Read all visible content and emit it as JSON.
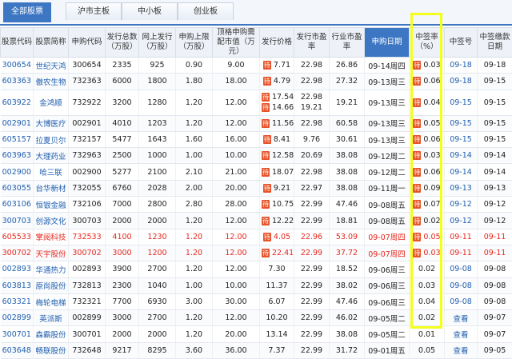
{
  "tabs": [
    "全部股票",
    "沪市主板",
    "中小板",
    "创业板"
  ],
  "headers": [
    "股票代码",
    "股票简称",
    "申购代码",
    "发行总数（万股）",
    "网上发行（万股）",
    "申购上限（万股）",
    "顶格申购需配市值（万元）",
    "发行价格",
    "发行市盈率",
    "行业市盈率",
    "申购日期",
    "中签率（%）",
    "中签号",
    "中签缴款日期"
  ],
  "tag_label": "待",
  "rows": [
    {
      "code": "300654",
      "name": "世纪天鸿",
      "sub": "300654",
      "total": "2335",
      "online": "925",
      "limit": "0.90",
      "cap": "9.00",
      "price": "7.71",
      "pe": "22.98",
      "ind": "26.86",
      "date": "09-14周四",
      "rate": "0.03",
      "lot": "09-18",
      "pay": "09-18",
      "tag": true
    },
    {
      "code": "603363",
      "name": "傲农生物",
      "sub": "732363",
      "total": "6000",
      "online": "1800",
      "limit": "1.80",
      "cap": "18.00",
      "price": "4.79",
      "pe": "22.98",
      "ind": "27.32",
      "date": "09-13周三",
      "rate": "0.06",
      "lot": "09-18",
      "pay": "09-15",
      "tag": true
    },
    {
      "code": "603922",
      "name": "金鸿顺",
      "sub": "732922",
      "total": "3200",
      "online": "1280",
      "limit": "1.20",
      "cap": "12.00",
      "price": "17.54",
      "price2": "14.66",
      "pe": "22.98",
      "pe2": "19.21",
      "ind": "19.21",
      "date": "09-13周三",
      "rate": "0.04",
      "lot": "09-15",
      "pay": "09-15",
      "tag": true,
      "tall": true
    },
    {
      "code": "002901",
      "name": "大博医疗",
      "sub": "002901",
      "total": "4010",
      "online": "1203",
      "limit": "1.20",
      "cap": "12.00",
      "price": "11.56",
      "pe": "22.98",
      "ind": "60.58",
      "date": "09-13周三",
      "rate": "0.05",
      "lot": "09-15",
      "pay": "09-15",
      "tag": true
    },
    {
      "code": "605157",
      "name": "拉夏贝尔",
      "sub": "732157",
      "total": "5477",
      "online": "1643",
      "limit": "1.60",
      "cap": "16.00",
      "price": "8.41",
      "pe": "9.76",
      "ind": "30.61",
      "date": "09-13周三",
      "rate": "0.06",
      "lot": "09-15",
      "pay": "09-15",
      "tag": true
    },
    {
      "code": "603963",
      "name": "大理药业",
      "sub": "732963",
      "total": "2500",
      "online": "1000",
      "limit": "1.00",
      "cap": "10.00",
      "price": "12.58",
      "pe": "20.69",
      "ind": "38.08",
      "date": "09-12周二",
      "rate": "0.03",
      "lot": "09-14",
      "pay": "09-14",
      "tag": true
    },
    {
      "code": "002900",
      "name": "哈三联",
      "sub": "002900",
      "total": "5277",
      "online": "2100",
      "limit": "2.10",
      "cap": "21.00",
      "price": "18.07",
      "pe": "22.98",
      "ind": "38.08",
      "date": "09-12周二",
      "rate": "0.06",
      "lot": "09-14",
      "pay": "09-14",
      "tag": true
    },
    {
      "code": "603055",
      "name": "台华新材",
      "sub": "732055",
      "total": "6760",
      "online": "2028",
      "limit": "2.00",
      "cap": "20.00",
      "price": "9.21",
      "pe": "22.97",
      "ind": "38.08",
      "date": "09-11周一",
      "rate": "0.09",
      "lot": "09-13",
      "pay": "09-13",
      "tag": true
    },
    {
      "code": "603106",
      "name": "恒银金融",
      "sub": "732106",
      "total": "7000",
      "online": "2800",
      "limit": "2.80",
      "cap": "28.00",
      "price": "10.75",
      "pe": "22.99",
      "ind": "47.46",
      "date": "09-08周五",
      "rate": "0.07",
      "lot": "09-12",
      "pay": "09-12",
      "tag": true
    },
    {
      "code": "300703",
      "name": "创源文化",
      "sub": "300703",
      "total": "2000",
      "online": "2000",
      "limit": "1.20",
      "cap": "12.00",
      "price": "12.22",
      "pe": "22.99",
      "ind": "18.81",
      "date": "09-08周五",
      "rate": "0.02",
      "lot": "09-12",
      "pay": "09-12",
      "tag": true
    },
    {
      "code": "605533",
      "name": "掌阅科技",
      "sub": "732533",
      "total": "4100",
      "online": "1230",
      "limit": "1.20",
      "cap": "12.00",
      "price": "4.05",
      "pe": "22.96",
      "ind": "53.09",
      "date": "09-07周四",
      "rate": "0.05",
      "lot": "09-11",
      "pay": "09-11",
      "tag": true,
      "red": true
    },
    {
      "code": "300702",
      "name": "天宇股份",
      "sub": "300702",
      "total": "3000",
      "online": "1200",
      "limit": "1.20",
      "cap": "12.00",
      "price": "22.41",
      "pe": "22.99",
      "ind": "37.72",
      "date": "09-07周四",
      "rate": "0.03",
      "lot": "09-11",
      "pay": "09-11",
      "tag": true,
      "red": true
    },
    {
      "code": "002893",
      "name": "华通热力",
      "sub": "002893",
      "total": "3900",
      "online": "2700",
      "limit": "1.20",
      "cap": "12.00",
      "price": "7.30",
      "pe": "22.99",
      "ind": "18.52",
      "date": "09-06周三",
      "rate": "0.02",
      "lot": "09-08",
      "pay": "09-08"
    },
    {
      "code": "603813",
      "name": "原尚股份",
      "sub": "732813",
      "total": "2300",
      "online": "1040",
      "limit": "1.00",
      "cap": "10.00",
      "price": "11.37",
      "pe": "22.99",
      "ind": "38.02",
      "date": "09-06周三",
      "rate": "0.03",
      "lot": "09-08",
      "pay": "09-08"
    },
    {
      "code": "603321",
      "name": "梅轮电梯",
      "sub": "732321",
      "total": "7700",
      "online": "6930",
      "limit": "3.00",
      "cap": "30.00",
      "price": "6.07",
      "pe": "22.99",
      "ind": "47.46",
      "date": "09-06周三",
      "rate": "0.04",
      "lot": "09-08",
      "pay": "09-08"
    },
    {
      "code": "002899",
      "name": "英派斯",
      "sub": "002899",
      "total": "3000",
      "online": "2700",
      "limit": "1.20",
      "cap": "12.00",
      "price": "10.20",
      "pe": "22.99",
      "ind": "46.02",
      "date": "09-05周二",
      "rate": "0.02",
      "lot": "查看",
      "pay": "09-07"
    },
    {
      "code": "300701",
      "name": "森霸股份",
      "sub": "300701",
      "total": "2000",
      "online": "2000",
      "limit": "1.20",
      "cap": "20.00",
      "price": "13.14",
      "pe": "22.99",
      "ind": "38.08",
      "date": "09-05周二",
      "rate": "0.01",
      "lot": "查看",
      "pay": "09-07"
    },
    {
      "code": "603648",
      "name": "畅联股份",
      "sub": "732648",
      "total": "9217",
      "online": "8295",
      "limit": "3.60",
      "cap": "36.00",
      "price": "7.37",
      "pe": "22.99",
      "ind": "31.72",
      "date": "09-01周五",
      "rate": "0.05",
      "lot": "查看",
      "pay": "09-05"
    }
  ]
}
